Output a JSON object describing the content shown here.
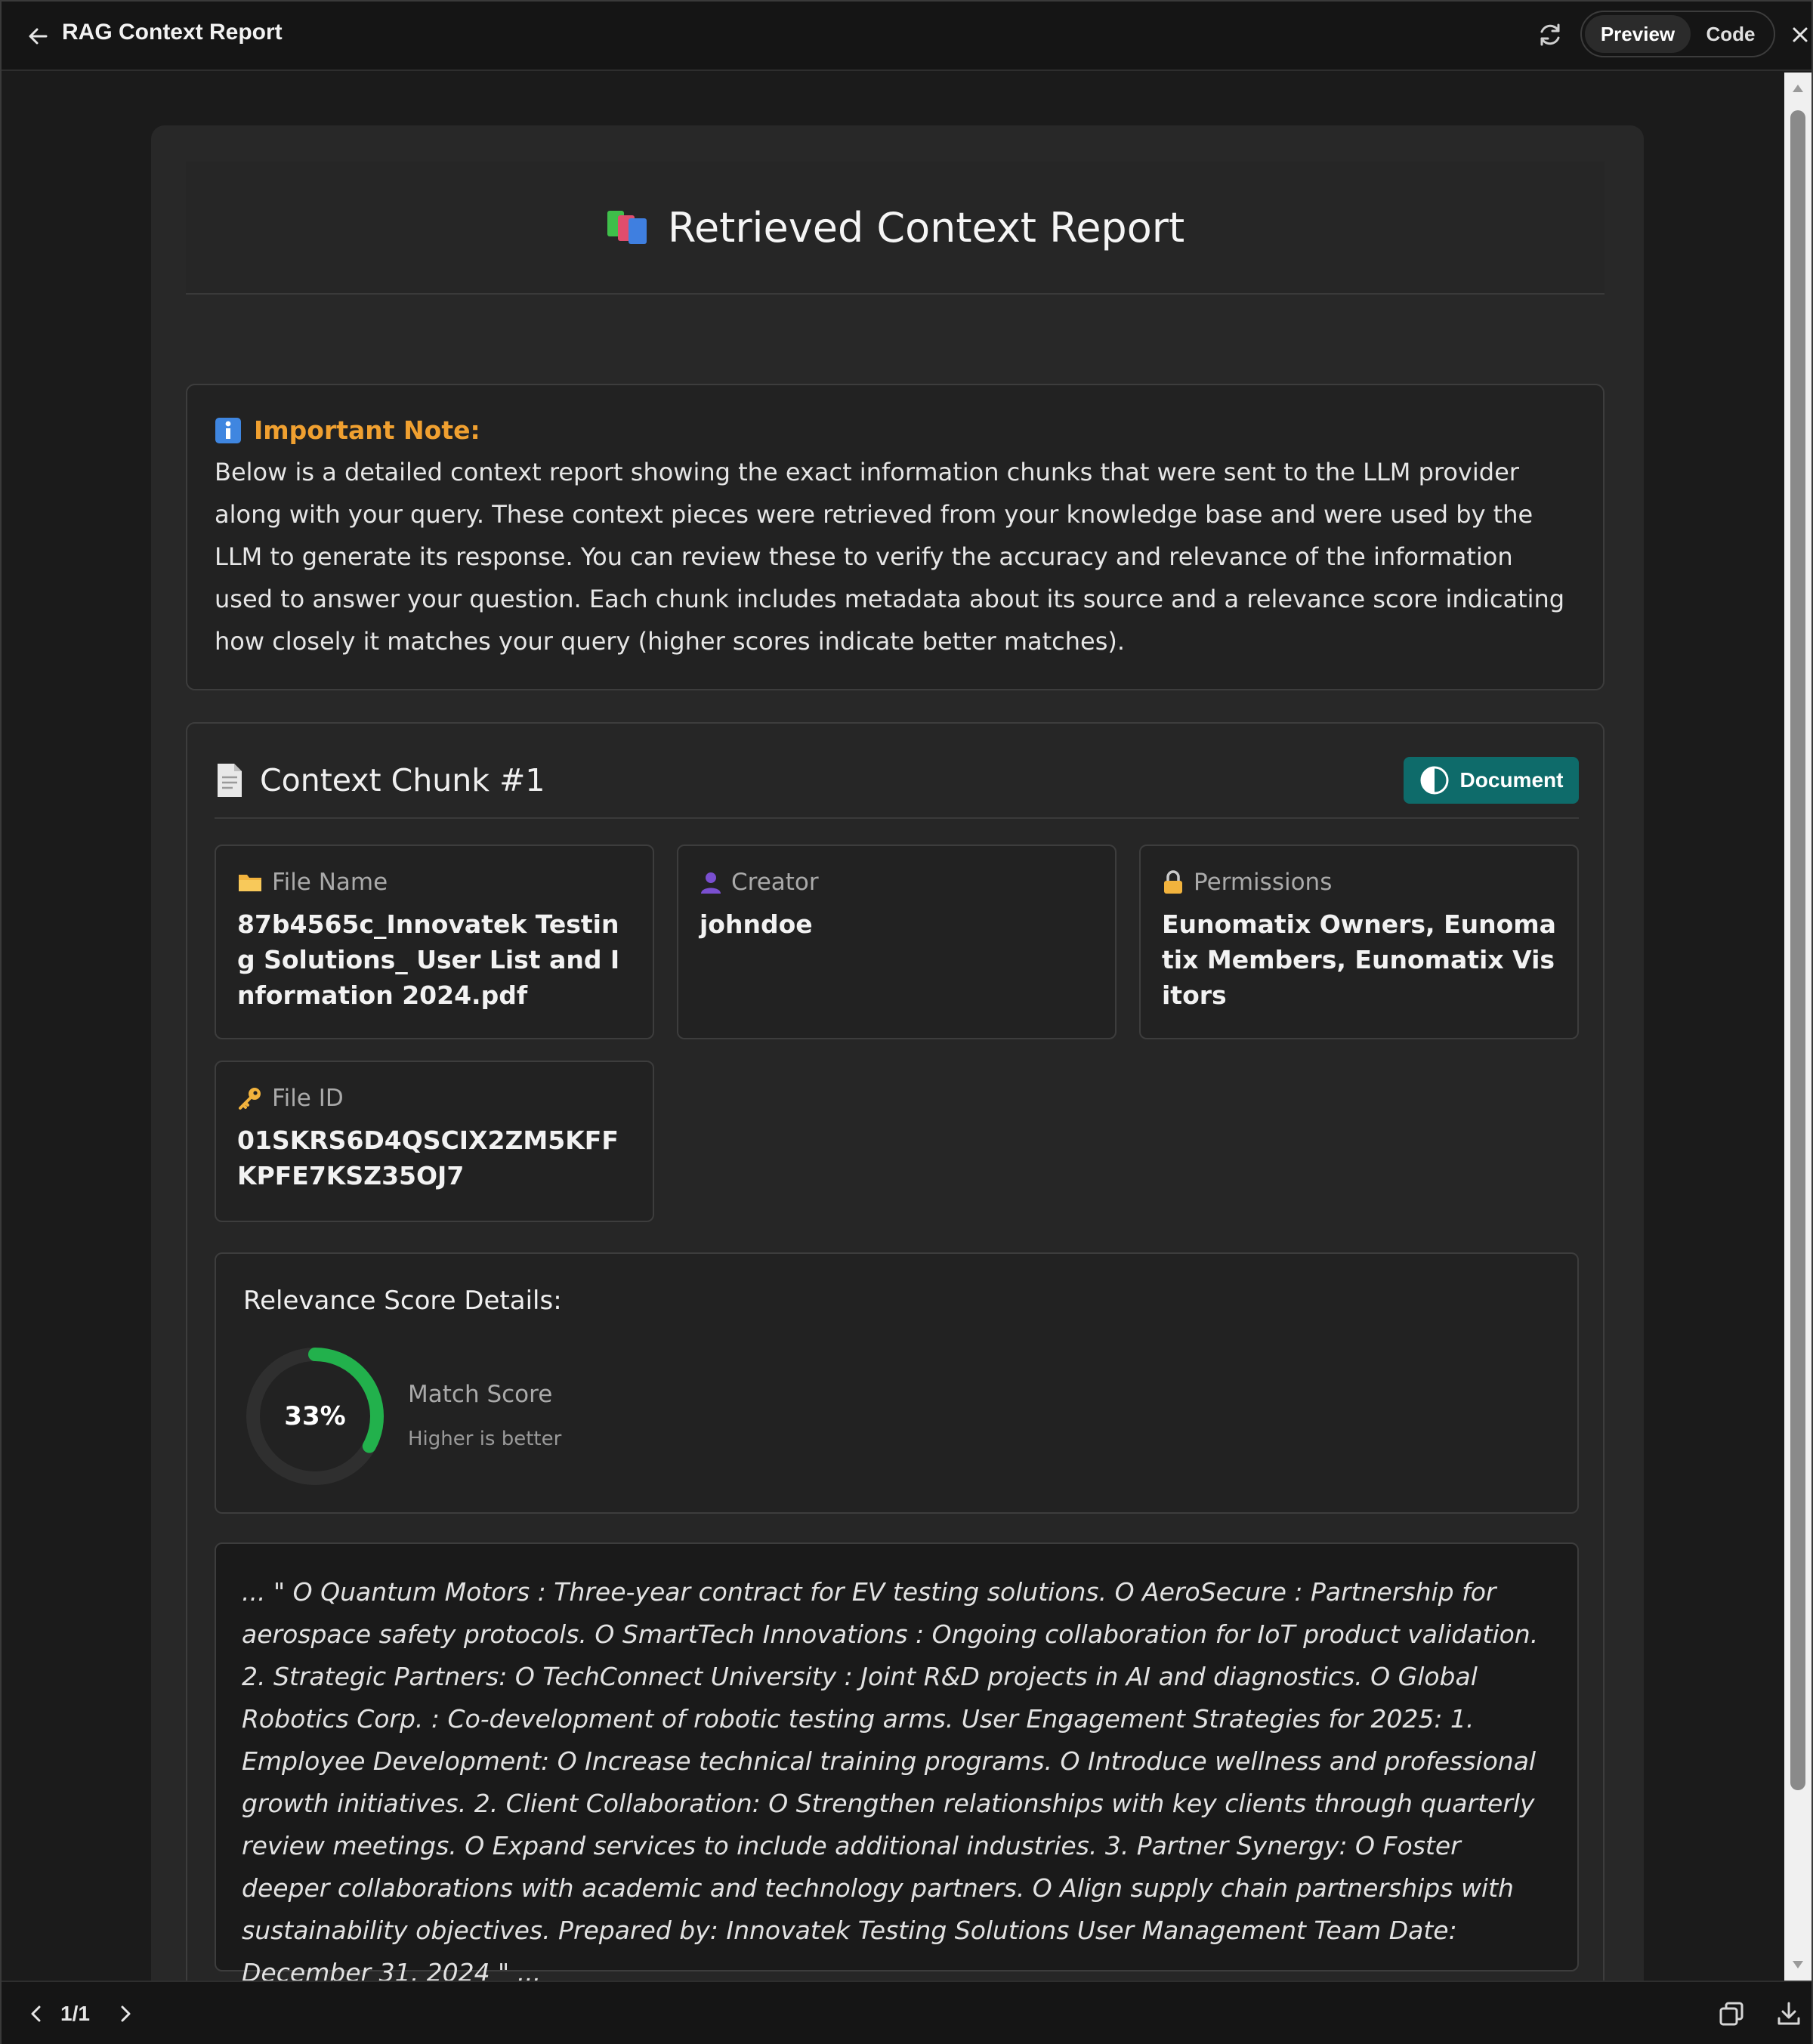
{
  "window": {
    "title": "RAG Context Report",
    "tabs": {
      "preview": "Preview",
      "code": "Code",
      "active": "Preview"
    }
  },
  "report": {
    "title": "Retrieved Context Report",
    "note": {
      "label": "Important Note:",
      "text": "Below is a detailed context report showing the exact information chunks that were sent to the LLM provider along with your query. These context pieces were retrieved from your knowledge base and were used by the LLM to generate its response. You can review these to verify the accuracy and relevance of the information used to answer your question. Each chunk includes metadata about its source and a relevance score indicating how closely it matches your query (higher scores indicate better matches)."
    },
    "chunk": {
      "title": "Context Chunk #1",
      "badge": "Document",
      "file_name_label": "File Name",
      "file_name": "87b4565c_Innovatek Testing Solutions_ User List and Information 2024.pdf",
      "creator_label": "Creator",
      "creator": "johndoe",
      "permissions_label": "Permissions",
      "permissions": "Eunomatix Owners, Eunomatix Members, Eunomatix Visitors",
      "file_id_label": "File ID",
      "file_id": "01SKRS6D4QSCIX2ZM5KFFKPFE7KSZ35OJ7",
      "relevance_title": "Relevance Score Details:",
      "score_text": "33%",
      "score_value": 0.33,
      "score_label": "Match Score",
      "score_sub": "Higher is better",
      "excerpt": "... \" O Quantum Motors : Three-year contract for EV testing solutions. O AeroSecure : Partnership for aerospace safety protocols. O SmartTech Innovations : Ongoing collaboration for IoT product validation. 2. Strategic Partners: O TechConnect University : Joint R&D projects in AI and diagnostics. O Global Robotics Corp. : Co-development of robotic testing arms. User Engagement Strategies for 2025: 1. Employee Development: O Increase technical training programs. O Introduce wellness and professional growth initiatives. 2. Client Collaboration: O Strengthen relationships with key clients through quarterly review meetings. O Expand services to include additional industries. 3. Partner Synergy: O Foster deeper collaborations with academic and technology partners. O Align supply chain partnerships with sustainability objectives. Prepared by: Innovatek Testing Solutions User Management Team Date: December 31, 2024 \" ..."
    }
  },
  "pager": {
    "indicator": "1/1"
  },
  "colors": {
    "accent_note": "#f0a030",
    "badge_bg": "#0e6b6a",
    "gauge_fill": "#22b14c",
    "gauge_track": "#2f2f2f"
  },
  "icons": {
    "back": "arrow-left-icon",
    "refresh": "refresh-icon",
    "close": "close-icon",
    "report": "books-icon",
    "info": "info-icon",
    "chunk": "document-page-icon",
    "badge": "half-circle-icon",
    "file_name": "folder-icon",
    "creator": "user-icon",
    "permissions": "lock-icon",
    "file_id": "key-icon",
    "prev": "chevron-left-icon",
    "next": "chevron-right-icon",
    "copy": "copy-icon",
    "download": "download-icon"
  }
}
